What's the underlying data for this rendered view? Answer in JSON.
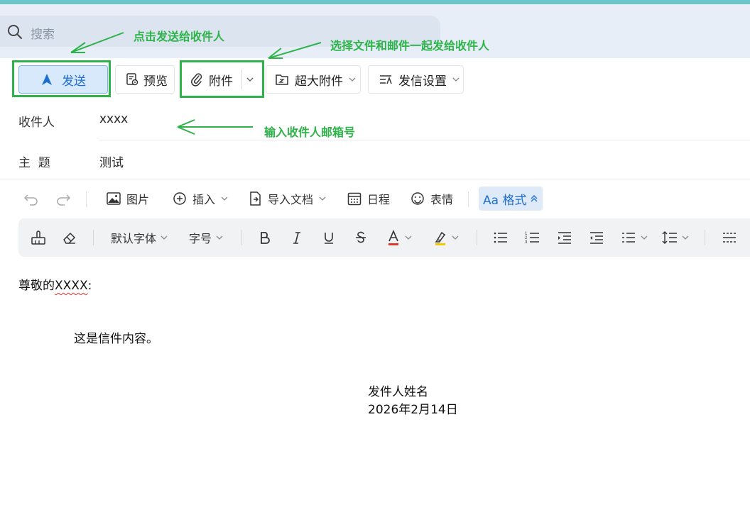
{
  "search": {
    "placeholder": "搜索"
  },
  "toolbar": {
    "send": "发送",
    "preview": "预览",
    "attachment": "附件",
    "large_attachment": "超大附件",
    "send_settings": "发信设置"
  },
  "fields": {
    "recipient_label": "收件人",
    "recipient_value": "xxxx",
    "subject_label": "主  题",
    "subject_value": "测试"
  },
  "editor_toolbar": {
    "image": "图片",
    "insert": "插入",
    "import_doc": "导入文档",
    "schedule": "日程",
    "emoji": "表情",
    "format": "Aa 格式"
  },
  "format_toolbar": {
    "font_family": "默认字体",
    "font_size": "字号",
    "colors": {
      "text": "#e0342f",
      "highlight": "#f2c800"
    }
  },
  "annotations": {
    "send_hint": "点击发送给收件人",
    "attach_hint": "选择文件和邮件一起发给收件人",
    "recipient_hint": "输入收件人邮箱号"
  },
  "body": {
    "greeting_prefix": "尊敬的",
    "greeting_name": "XXXX",
    "greeting_suffix": ":",
    "content": "这是信件内容。",
    "sender_name": "发件人姓名",
    "date": "2026年2月14日"
  },
  "colors": {
    "accent": "#1e6fd0",
    "annotation": "#2db34a"
  }
}
